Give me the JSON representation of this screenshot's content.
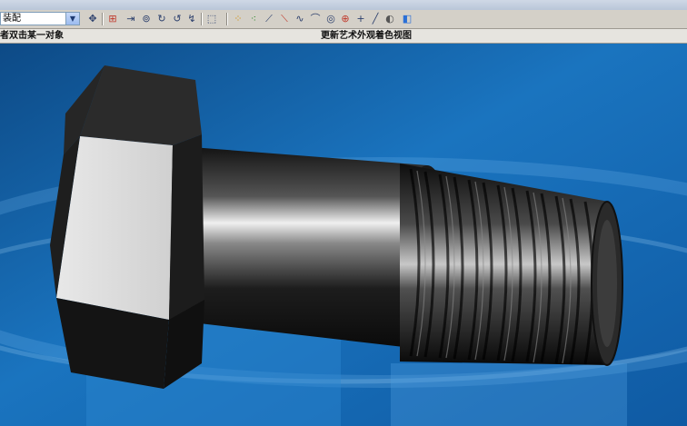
{
  "toolbar": {
    "assembly_combo": {
      "value": "装配"
    },
    "icons": [
      "component-icon",
      "assembly-icon",
      "axis-icon",
      "mate-icon",
      "view-icon",
      "redo-icon",
      "select-box-icon",
      "point-cloud-icon",
      "constraint-icon",
      "line-icon",
      "slash-icon",
      "curve-icon",
      "arc-icon",
      "circle-icon",
      "target-icon",
      "plus-icon",
      "diagonal-icon",
      "shade-icon",
      "cube-view-icon"
    ]
  },
  "status": {
    "prompt": "者双击某一对象",
    "view_mode": "更新艺术外观着色视图"
  },
  "viewport": {
    "model": "hex-bolt",
    "background_color": "#1565b0",
    "metal_color": "#2a2a2a"
  }
}
